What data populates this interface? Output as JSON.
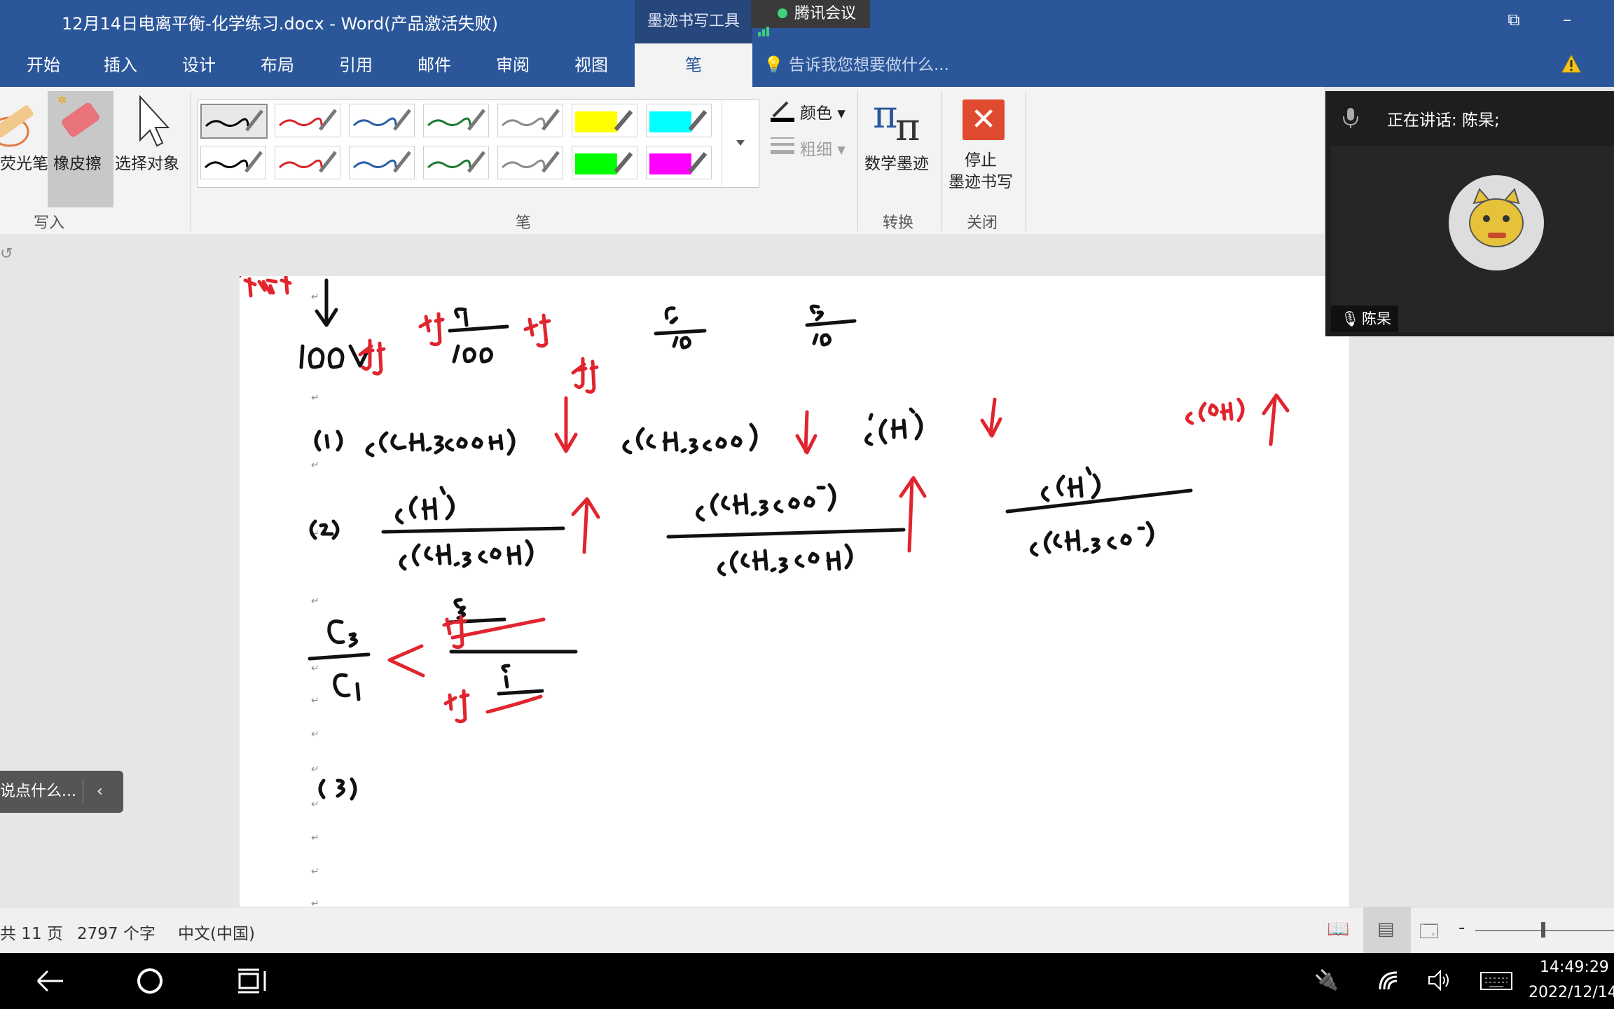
{
  "window": {
    "title": "12月14日电离平衡-化学练习.docx - Word(产品激活失败)",
    "context_tab": "墨迹书写工具"
  },
  "meeting": {
    "label": "腾讯会议",
    "speaking": "正在讲话: 陈杲;",
    "participant_name": "陈杲"
  },
  "tabs": [
    "开始",
    "插入",
    "设计",
    "布局",
    "引用",
    "邮件",
    "审阅",
    "视图",
    "笔"
  ],
  "tell_me": "告诉我您想要做什么...",
  "ribbon": {
    "write_tools": {
      "highlighter": "荧光笔",
      "eraser": "橡皮擦",
      "select": "选择对象",
      "group": "写入"
    },
    "pens": {
      "group": "笔",
      "row1": [
        "#000000",
        "#d9262d",
        "#2b5fa6",
        "#1f7a33",
        "#8c8c8c",
        "#ffff00",
        "#00ffff"
      ],
      "row2": [
        "#000000",
        "#d9262d",
        "#2b5fa6",
        "#1f7a33",
        "#8c8c8c",
        "#00ff00",
        "#ff00ff"
      ]
    },
    "color_label": "颜色",
    "thickness_label": "粗细",
    "convert": {
      "math": "数学墨迹",
      "group": "转换"
    },
    "close": {
      "stop_line1": "停止",
      "stop_line2": "墨迹书写",
      "group": "关闭"
    }
  },
  "comment_placeholder": "说点什么...",
  "status": {
    "page": "共 11 页",
    "words": "2797 个字",
    "language": "中文(中国)"
  },
  "taskbar": {
    "time": "14:49:29",
    "date": "2022/12/14"
  },
  "icons": [
    "back-icon",
    "home-icon",
    "task-view-icon",
    "power-icon",
    "wifi-icon",
    "volume-icon",
    "keyboard-icon",
    "mic-icon",
    "warning-icon"
  ],
  "colors": {
    "ribbon_blue": "#2b579a",
    "ink_red": "#e0252e",
    "ink_black": "#111111"
  }
}
